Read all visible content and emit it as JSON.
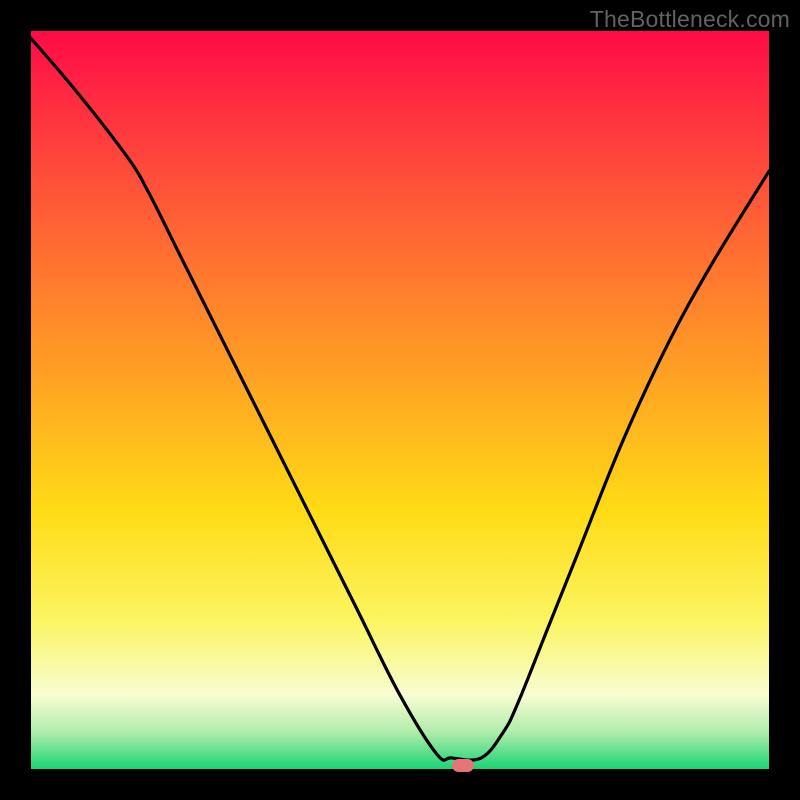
{
  "watermark": "TheBottleneck.com",
  "chart_data": {
    "type": "line",
    "title": "",
    "xlabel": "",
    "ylabel": "",
    "xlim": [
      0,
      100
    ],
    "ylim": [
      0,
      100
    ],
    "grid": false,
    "series": [
      {
        "name": "bottleneck-curve",
        "x": [
          0,
          6,
          13,
          16,
          20,
          26,
          32,
          38,
          44,
          50,
          55,
          57,
          61,
          64,
          66,
          70,
          74,
          80,
          86,
          92,
          100
        ],
        "values": [
          99,
          92,
          83,
          78,
          70,
          58,
          46,
          34,
          22,
          10,
          2,
          1.5,
          1.5,
          5,
          9,
          19,
          29,
          44,
          57,
          68,
          81
        ]
      }
    ],
    "gradient_stops": [
      {
        "pct": 0,
        "color": "#ff0b47"
      },
      {
        "pct": 20,
        "color": "#ff4f3a"
      },
      {
        "pct": 45,
        "color": "#ff9c25"
      },
      {
        "pct": 65,
        "color": "#ffdb15"
      },
      {
        "pct": 80,
        "color": "#fbf562"
      },
      {
        "pct": 90,
        "color": "#f8fdd2"
      },
      {
        "pct": 95,
        "color": "#b0ecab"
      },
      {
        "pct": 100,
        "color": "#19d574"
      }
    ],
    "marker": {
      "x_pct": 58.5,
      "color": "#e57477"
    }
  }
}
